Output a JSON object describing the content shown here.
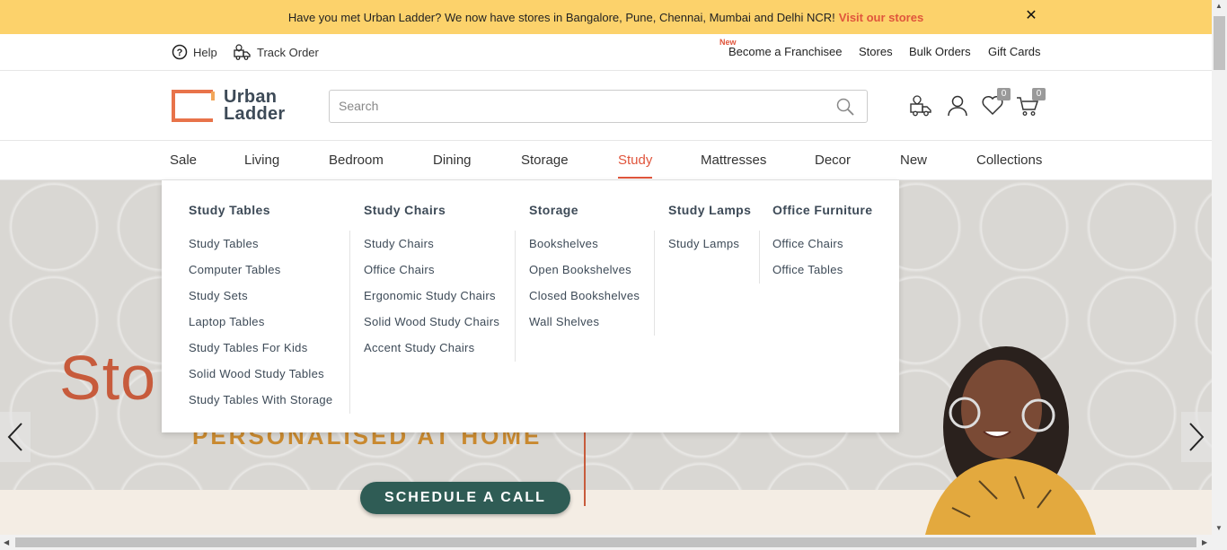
{
  "promo": {
    "text": "Have you met Urban Ladder? We now have stores in Bangalore, Pune, Chennai, Mumbai and Delhi NCR!",
    "link": "Visit our stores",
    "close": "✕"
  },
  "utility": {
    "help": "Help",
    "track": "Track Order",
    "new_tag": "New",
    "franchise": "Become a Franchisee",
    "stores": "Stores",
    "bulk": "Bulk Orders",
    "gift": "Gift Cards"
  },
  "header": {
    "logo_line1": "Urban",
    "logo_line2": "Ladder",
    "search_placeholder": "Search",
    "wishlist_count": "0",
    "cart_count": "0"
  },
  "nav": {
    "items": [
      "Sale",
      "Living",
      "Bedroom",
      "Dining",
      "Storage",
      "Study",
      "Mattresses",
      "Decor",
      "New",
      "Collections"
    ],
    "active": "Study"
  },
  "megamenu": {
    "columns": [
      {
        "heading": "Study Tables",
        "links": [
          "Study Tables",
          "Computer Tables",
          "Study Sets",
          "Laptop Tables",
          "Study Tables For Kids",
          "Solid Wood Study Tables",
          "Study Tables With Storage"
        ]
      },
      {
        "heading": "Study Chairs",
        "links": [
          "Study Chairs",
          "Office Chairs",
          "Ergonomic Study Chairs",
          "Solid Wood Study Chairs",
          "Accent Study Chairs"
        ]
      },
      {
        "heading": "Storage",
        "links": [
          "Bookshelves",
          "Open Bookshelves",
          "Closed Bookshelves",
          "Wall Shelves"
        ]
      },
      {
        "heading": "Study Lamps",
        "links": [
          "Study Lamps"
        ]
      },
      {
        "heading": "Office Furniture",
        "links": [
          "Office Chairs",
          "Office Tables"
        ]
      }
    ]
  },
  "hero": {
    "title": "Sto",
    "subtitle": "PERSONALISED AT HOME",
    "cta": "SCHEDULE A CALL"
  }
}
